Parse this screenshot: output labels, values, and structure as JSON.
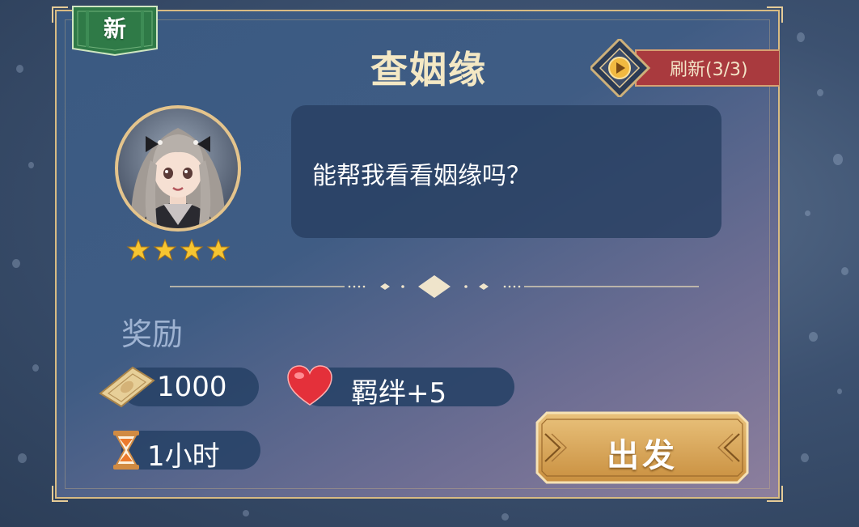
{
  "badge": {
    "label": "新"
  },
  "header": {
    "title": "查姻缘"
  },
  "refresh": {
    "label": "刷新(3/3)"
  },
  "character": {
    "stars": 4
  },
  "dialogue": {
    "text": "能帮我看看姻缘吗？"
  },
  "rewards": {
    "title": "奖励",
    "money": "1000",
    "bond": "羁绊+5",
    "duration": "1小时"
  },
  "action": {
    "go_label": "出发"
  },
  "colors": {
    "gold": "#d8bb83",
    "ribbon_green": "#2f7a47",
    "refresh_red": "#a93a3e"
  }
}
